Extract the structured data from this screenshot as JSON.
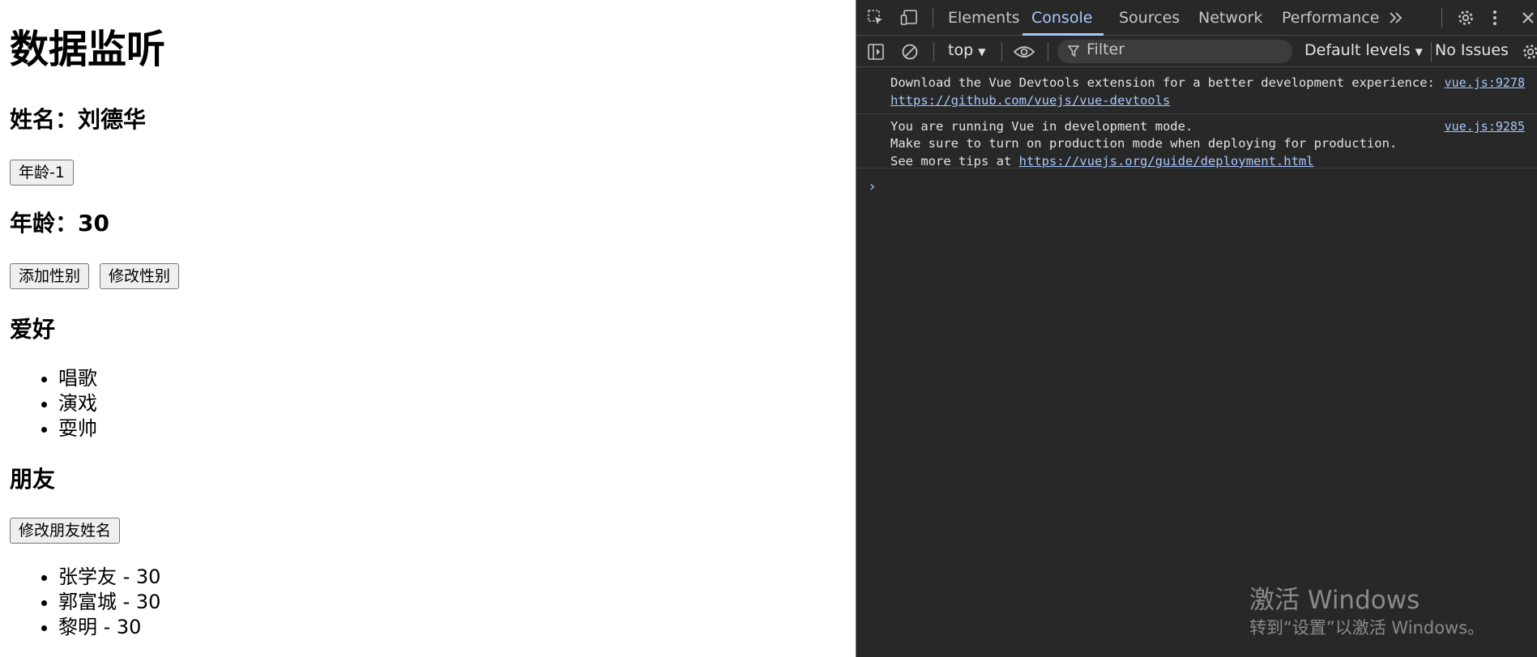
{
  "page": {
    "heading": "数据监听",
    "name_line": "姓名：刘德华",
    "age_minus_button": "年龄-1",
    "age_line": "年龄：30",
    "add_gender_button": "添加性别",
    "modify_gender_button": "修改性别",
    "hobbies_heading": "爱好",
    "hobbies": [
      "唱歌",
      "演戏",
      "耍帅"
    ],
    "friends_heading": "朋友",
    "modify_friend_button": "修改朋友姓名",
    "friends": [
      "张学友 - 30",
      "郭富城 - 30",
      "黎明 - 30"
    ]
  },
  "devtools": {
    "tabs": [
      "Elements",
      "Console",
      "Sources",
      "Network",
      "Performance"
    ],
    "active_tab": "Console",
    "more_tabs_icon": "double-chevron-icon",
    "context": "top",
    "filter_placeholder": "Filter",
    "levels": "Default levels",
    "issues": "No Issues",
    "messages": [
      {
        "lines": [
          "Download the Vue Devtools extension for a better development experience:"
        ],
        "link": "https://github.com/vuejs/vue-devtools",
        "source": "vue.js:9278"
      },
      {
        "lines": [
          "You are running Vue in development mode.",
          "Make sure to turn on production mode when deploying for production.",
          "See more tips at "
        ],
        "link": "https://vuejs.org/guide/deployment.html",
        "source": "vue.js:9285"
      }
    ],
    "prompt": "›"
  },
  "watermark": {
    "line1": "激活 Windows",
    "line2": "转到“设置”以激活 Windows。"
  },
  "colors": {
    "devtools_bg": "#282828",
    "accent": "#a8c7fa",
    "text": "#e3e3e3"
  }
}
